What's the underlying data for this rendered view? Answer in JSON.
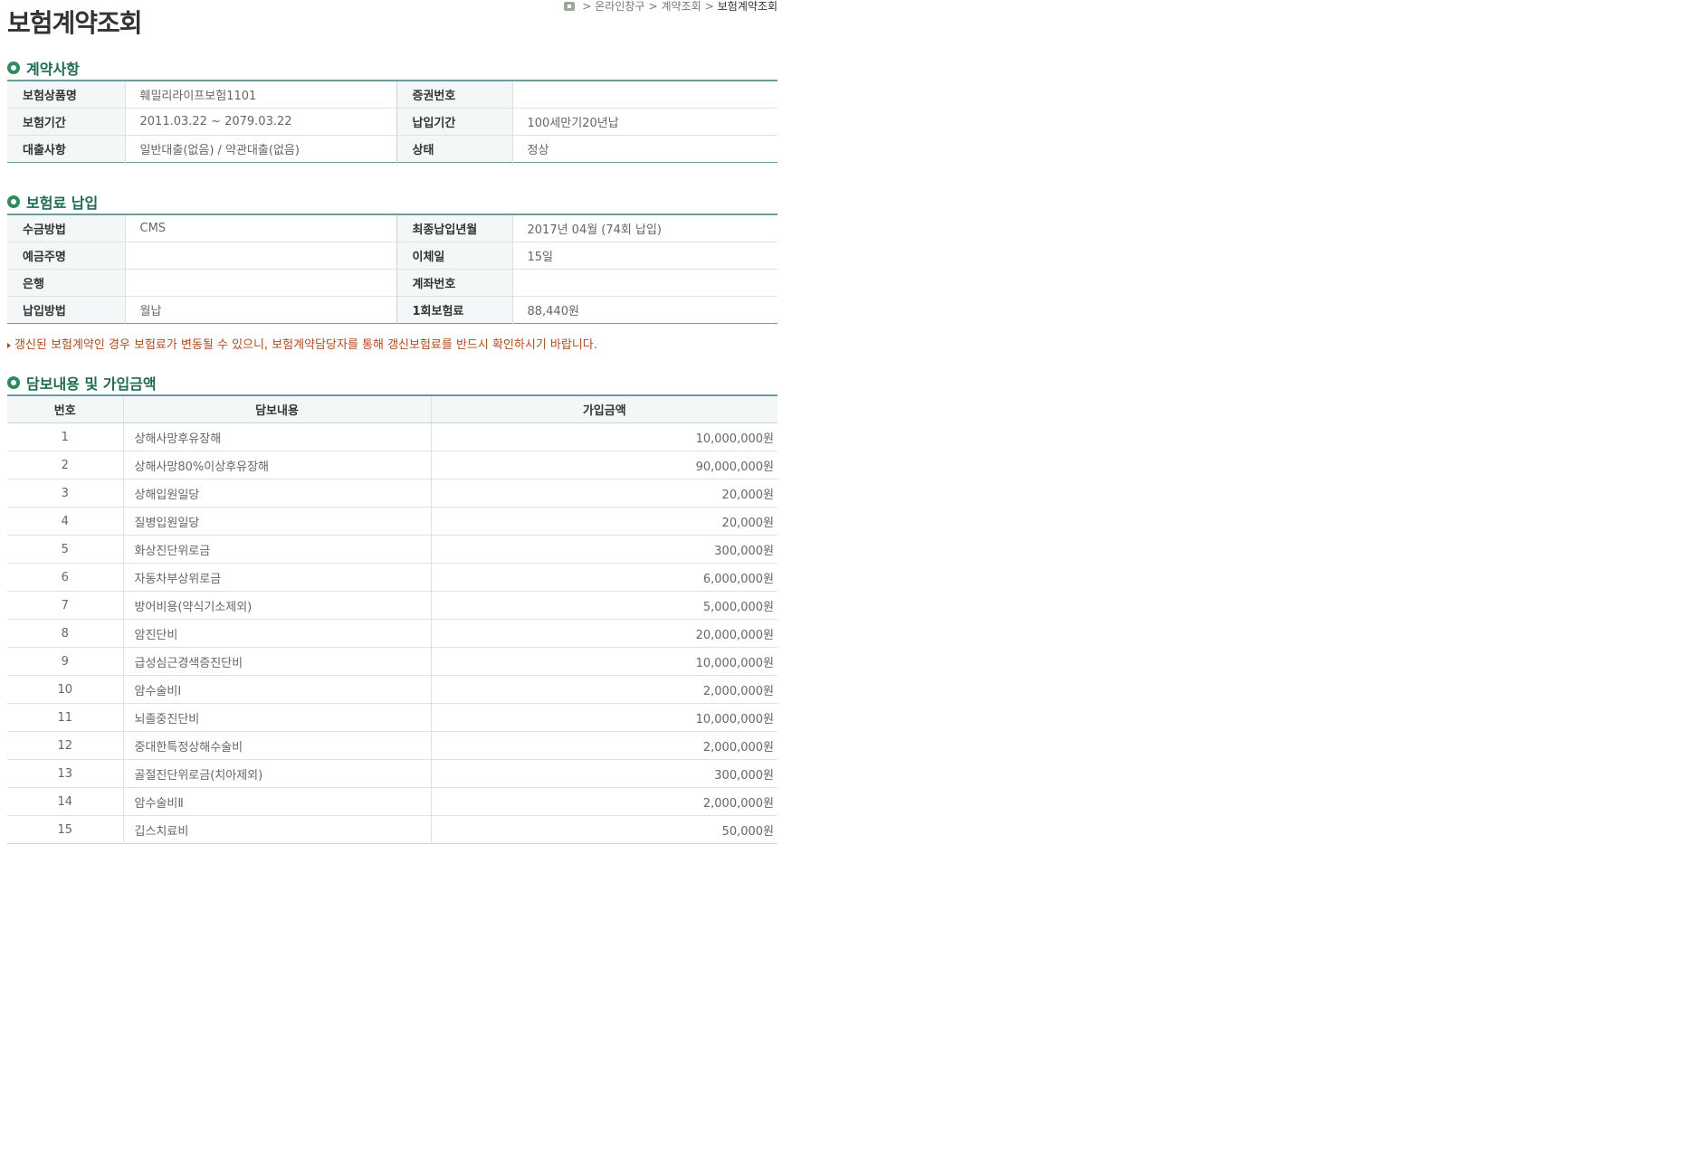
{
  "page_title": "보험계약조회",
  "breadcrumb": {
    "items": [
      "온라인창구",
      "계약조회"
    ],
    "current": "보험계약조회",
    "separator": ">"
  },
  "contract": {
    "title": "계약사항",
    "rows": [
      {
        "label1": "보험상품명",
        "value1": "훼밀리라이프보험1101",
        "label2": "증권번호",
        "value2": ""
      },
      {
        "label1": "보험기간",
        "value1": "2011.03.22 ~ 2079.03.22",
        "label2": "납입기간",
        "value2": "100세만기20년납"
      },
      {
        "label1": "대출사항",
        "value1": "일반대출(없음) / 약관대출(없음)",
        "label2": "상태",
        "value2": "정상"
      }
    ]
  },
  "payment": {
    "title": "보험료 납입",
    "rows": [
      {
        "label1": "수금방법",
        "value1": "CMS",
        "label2": "최종납입년월",
        "value2": "2017년 04월 (74회 납입)"
      },
      {
        "label1": "예금주명",
        "value1": "",
        "label2": "이체일",
        "value2": "15일"
      },
      {
        "label1": "은행",
        "value1": "",
        "label2": "계좌번호",
        "value2": ""
      },
      {
        "label1": "납입방법",
        "value1": "월납",
        "label2": "1회보험료",
        "value2": "88,440원"
      }
    ],
    "notice": "갱신된 보험계약인 경우 보험료가 변동될 수 있으니, 보험계약담당자를 통해 갱신보험료를 반드시 확인하시기 바랍니다."
  },
  "coverage": {
    "title": "담보내용 및 가입금액",
    "headers": {
      "num": "번호",
      "name": "담보내용",
      "amount": "가입금액"
    },
    "rows": [
      {
        "num": "1",
        "name": "상해사망후유장해",
        "amount": "10,000,000원"
      },
      {
        "num": "2",
        "name": "상해사망80%이상후유장해",
        "amount": "90,000,000원"
      },
      {
        "num": "3",
        "name": "상해입원일당",
        "amount": "20,000원"
      },
      {
        "num": "4",
        "name": "질병입원일당",
        "amount": "20,000원"
      },
      {
        "num": "5",
        "name": "화상진단위로금",
        "amount": "300,000원"
      },
      {
        "num": "6",
        "name": "자동차부상위로금",
        "amount": "6,000,000원"
      },
      {
        "num": "7",
        "name": "방어비용(약식기소제외)",
        "amount": "5,000,000원"
      },
      {
        "num": "8",
        "name": "암진단비",
        "amount": "20,000,000원"
      },
      {
        "num": "9",
        "name": "급성심근경색증진단비",
        "amount": "10,000,000원"
      },
      {
        "num": "10",
        "name": "암수술비Ⅰ",
        "amount": "2,000,000원"
      },
      {
        "num": "11",
        "name": "뇌졸중진단비",
        "amount": "10,000,000원"
      },
      {
        "num": "12",
        "name": "중대한특정상해수술비",
        "amount": "2,000,000원"
      },
      {
        "num": "13",
        "name": "골절진단위로금(치아제외)",
        "amount": "300,000원"
      },
      {
        "num": "14",
        "name": "암수술비Ⅱ",
        "amount": "2,000,000원"
      },
      {
        "num": "15",
        "name": "깁스치료비",
        "amount": "50,000원"
      }
    ]
  }
}
